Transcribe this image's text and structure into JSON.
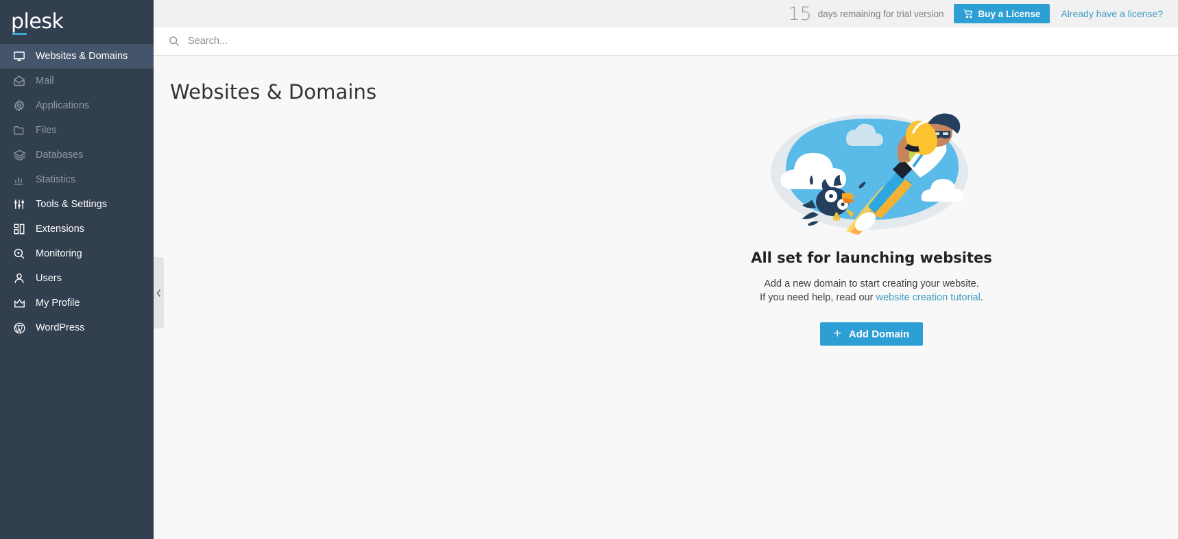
{
  "brand": {
    "logo_text": "plesk",
    "accent_color": "#3ba9d4",
    "sidebar_color": "#323f4f",
    "sidebar_active_color": "#44546a",
    "button_color": "#2e9fd4",
    "link_color": "#3c9bc4"
  },
  "sidebar": {
    "items": [
      {
        "label": "Websites & Domains",
        "icon": "monitor-icon",
        "state": "active"
      },
      {
        "label": "Mail",
        "icon": "envelope-icon",
        "state": "dim"
      },
      {
        "label": "Applications",
        "icon": "gear-icon",
        "state": "dim"
      },
      {
        "label": "Files",
        "icon": "folder-icon",
        "state": "dim"
      },
      {
        "label": "Databases",
        "icon": "database-icon",
        "state": "dim"
      },
      {
        "label": "Statistics",
        "icon": "bar-chart-icon",
        "state": "dim"
      },
      {
        "label": "Tools & Settings",
        "icon": "sliders-icon",
        "state": "bright"
      },
      {
        "label": "Extensions",
        "icon": "blocks-icon",
        "state": "bright"
      },
      {
        "label": "Monitoring",
        "icon": "magnifier-dot-icon",
        "state": "bright"
      },
      {
        "label": "Users",
        "icon": "user-icon",
        "state": "bright"
      },
      {
        "label": "My Profile",
        "icon": "crown-icon",
        "state": "bright"
      },
      {
        "label": "WordPress",
        "icon": "wordpress-icon",
        "state": "bright"
      }
    ],
    "collapse_icon": "chevron-left-icon"
  },
  "topbar": {
    "trial_days": "15",
    "trial_text": "days remaining for trial version",
    "buy_label": "Buy a License",
    "buy_icon": "cart-icon",
    "already_license_label": "Already have a license?"
  },
  "search": {
    "placeholder": "Search...",
    "value": "",
    "icon": "search-icon"
  },
  "main": {
    "page_title": "Websites & Domains",
    "empty_state": {
      "illustration": "person-jetpack-flying-with-bird-illustration",
      "heading": "All set for launching websites",
      "line1": "Add a new domain to start creating your website.",
      "line2_prefix": "If you need help, read our ",
      "line2_link": "website creation tutorial",
      "line2_suffix": ".",
      "add_domain_label": "Add Domain",
      "add_domain_icon": "plus-icon"
    }
  }
}
